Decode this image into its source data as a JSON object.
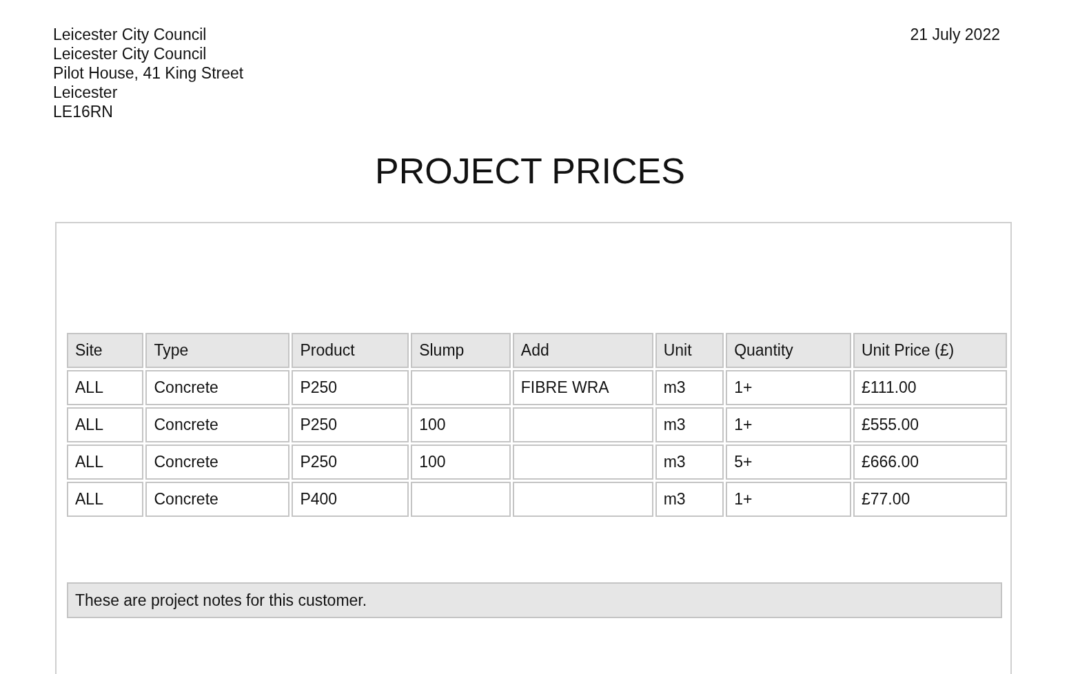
{
  "address": [
    "Leicester City Council",
    "Leicester City Council",
    "Pilot House, 41 King Street",
    "Leicester",
    "LE16RN"
  ],
  "date": "21 July 2022",
  "title": "PROJECT PRICES",
  "table": {
    "columns": [
      "Site",
      "Type",
      "Product",
      "Slump",
      "Add",
      "Unit",
      "Quantity",
      "Unit Price (£)"
    ],
    "rows": [
      [
        "ALL",
        "Concrete",
        "P250",
        "",
        "FIBRE WRA",
        "m3",
        "1+",
        "£111.00"
      ],
      [
        "ALL",
        "Concrete",
        "P250",
        "100",
        "",
        "m3",
        "1+",
        "£555.00"
      ],
      [
        "ALL",
        "Concrete",
        "P250",
        "100",
        "",
        "m3",
        "5+",
        "£666.00"
      ],
      [
        "ALL",
        "Concrete",
        "P400",
        "",
        "",
        "m3",
        "1+",
        "£77.00"
      ]
    ]
  },
  "notes": "These are project notes for this customer."
}
